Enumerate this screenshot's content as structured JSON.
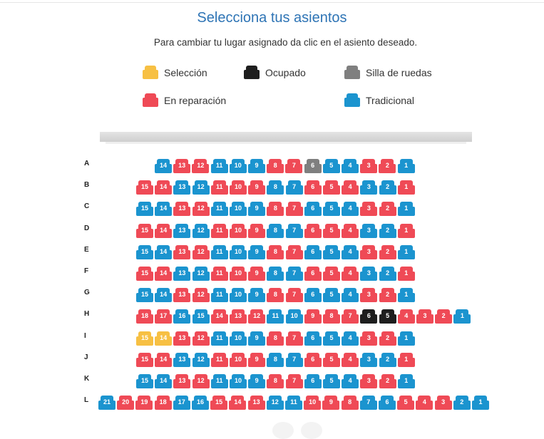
{
  "page": {
    "title": "Selecciona tus asientos",
    "subtitle": "Para cambiar tu lugar asignado da clic en el asiento deseado."
  },
  "colors": {
    "seleccion": "#f7c043",
    "ocupado": "#1e1e1e",
    "silla": "#7f7f7f",
    "reparacion": "#ef4a56",
    "tradicional": "#1b94cf"
  },
  "legend": [
    {
      "key": "seleccion",
      "label": "Selección",
      "icon": "seat-icon"
    },
    {
      "key": "ocupado",
      "label": "Ocupado",
      "icon": "seat-icon"
    },
    {
      "key": "silla",
      "label": "Silla de ruedas",
      "icon": "seat-icon"
    },
    {
      "key": "reparacion",
      "label": "En reparación",
      "icon": "seat-icon"
    },
    {
      "key": "tradicional",
      "label": "Tradicional",
      "icon": "seat-icon"
    }
  ],
  "screen_label": "",
  "rows": [
    {
      "label": "A",
      "seats": [
        [
          "14",
          "t"
        ],
        [
          "13",
          "r"
        ],
        [
          "12",
          "r"
        ],
        [
          "11",
          "t"
        ],
        [
          "10",
          "t"
        ],
        [
          "9",
          "t"
        ],
        [
          "8",
          "r"
        ],
        [
          "7",
          "r"
        ],
        [
          "6",
          "w"
        ],
        [
          "5",
          "t"
        ],
        [
          "4",
          "t"
        ],
        [
          "3",
          "r"
        ],
        [
          "2",
          "r"
        ],
        [
          "1",
          "t"
        ]
      ]
    },
    {
      "label": "B",
      "seats": [
        [
          "15",
          "r"
        ],
        [
          "14",
          "r"
        ],
        [
          "13",
          "t"
        ],
        [
          "12",
          "t"
        ],
        [
          "11",
          "r"
        ],
        [
          "10",
          "r"
        ],
        [
          "9",
          "r"
        ],
        [
          "8",
          "t"
        ],
        [
          "7",
          "t"
        ],
        [
          "6",
          "r"
        ],
        [
          "5",
          "r"
        ],
        [
          "4",
          "r"
        ],
        [
          "3",
          "t"
        ],
        [
          "2",
          "t"
        ],
        [
          "1",
          "r"
        ]
      ]
    },
    {
      "label": "C",
      "seats": [
        [
          "15",
          "t"
        ],
        [
          "14",
          "t"
        ],
        [
          "13",
          "r"
        ],
        [
          "12",
          "r"
        ],
        [
          "11",
          "t"
        ],
        [
          "10",
          "t"
        ],
        [
          "9",
          "t"
        ],
        [
          "8",
          "r"
        ],
        [
          "7",
          "r"
        ],
        [
          "6",
          "t"
        ],
        [
          "5",
          "t"
        ],
        [
          "4",
          "t"
        ],
        [
          "3",
          "r"
        ],
        [
          "2",
          "r"
        ],
        [
          "1",
          "t"
        ]
      ]
    },
    {
      "label": "D",
      "seats": [
        [
          "15",
          "r"
        ],
        [
          "14",
          "r"
        ],
        [
          "13",
          "t"
        ],
        [
          "12",
          "t"
        ],
        [
          "11",
          "r"
        ],
        [
          "10",
          "r"
        ],
        [
          "9",
          "r"
        ],
        [
          "8",
          "t"
        ],
        [
          "7",
          "t"
        ],
        [
          "6",
          "r"
        ],
        [
          "5",
          "r"
        ],
        [
          "4",
          "r"
        ],
        [
          "3",
          "t"
        ],
        [
          "2",
          "t"
        ],
        [
          "1",
          "r"
        ]
      ]
    },
    {
      "label": "E",
      "seats": [
        [
          "15",
          "t"
        ],
        [
          "14",
          "t"
        ],
        [
          "13",
          "r"
        ],
        [
          "12",
          "r"
        ],
        [
          "11",
          "t"
        ],
        [
          "10",
          "t"
        ],
        [
          "9",
          "t"
        ],
        [
          "8",
          "r"
        ],
        [
          "7",
          "r"
        ],
        [
          "6",
          "t"
        ],
        [
          "5",
          "t"
        ],
        [
          "4",
          "t"
        ],
        [
          "3",
          "r"
        ],
        [
          "2",
          "r"
        ],
        [
          "1",
          "t"
        ]
      ]
    },
    {
      "label": "F",
      "seats": [
        [
          "15",
          "r"
        ],
        [
          "14",
          "r"
        ],
        [
          "13",
          "t"
        ],
        [
          "12",
          "t"
        ],
        [
          "11",
          "r"
        ],
        [
          "10",
          "r"
        ],
        [
          "9",
          "r"
        ],
        [
          "8",
          "t"
        ],
        [
          "7",
          "t"
        ],
        [
          "6",
          "r"
        ],
        [
          "5",
          "r"
        ],
        [
          "4",
          "r"
        ],
        [
          "3",
          "t"
        ],
        [
          "2",
          "t"
        ],
        [
          "1",
          "r"
        ]
      ]
    },
    {
      "label": "G",
      "seats": [
        [
          "15",
          "t"
        ],
        [
          "14",
          "t"
        ],
        [
          "13",
          "r"
        ],
        [
          "12",
          "r"
        ],
        [
          "11",
          "t"
        ],
        [
          "10",
          "t"
        ],
        [
          "9",
          "t"
        ],
        [
          "8",
          "r"
        ],
        [
          "7",
          "r"
        ],
        [
          "6",
          "t"
        ],
        [
          "5",
          "t"
        ],
        [
          "4",
          "t"
        ],
        [
          "3",
          "r"
        ],
        [
          "2",
          "r"
        ],
        [
          "1",
          "t"
        ]
      ]
    },
    {
      "label": "H",
      "seats": [
        [
          "18",
          "r"
        ],
        [
          "17",
          "r"
        ],
        [
          "16",
          "t"
        ],
        [
          "15",
          "t"
        ],
        [
          "14",
          "r"
        ],
        [
          "13",
          "r"
        ],
        [
          "12",
          "r"
        ],
        [
          "11",
          "t"
        ],
        [
          "10",
          "t"
        ],
        [
          "9",
          "r"
        ],
        [
          "8",
          "r"
        ],
        [
          "7",
          "r"
        ],
        [
          "6",
          "o"
        ],
        [
          "5",
          "o"
        ],
        [
          "4",
          "r"
        ],
        [
          "3",
          "r"
        ],
        [
          "2",
          "r"
        ],
        [
          "1",
          "t"
        ]
      ]
    },
    {
      "label": "I",
      "seats": [
        [
          "15",
          "s"
        ],
        [
          "14",
          "s"
        ],
        [
          "13",
          "r"
        ],
        [
          "12",
          "r"
        ],
        [
          "11",
          "t"
        ],
        [
          "10",
          "t"
        ],
        [
          "9",
          "t"
        ],
        [
          "8",
          "r"
        ],
        [
          "7",
          "r"
        ],
        [
          "6",
          "t"
        ],
        [
          "5",
          "t"
        ],
        [
          "4",
          "t"
        ],
        [
          "3",
          "r"
        ],
        [
          "2",
          "r"
        ],
        [
          "1",
          "t"
        ]
      ]
    },
    {
      "label": "J",
      "seats": [
        [
          "15",
          "r"
        ],
        [
          "14",
          "r"
        ],
        [
          "13",
          "t"
        ],
        [
          "12",
          "t"
        ],
        [
          "11",
          "r"
        ],
        [
          "10",
          "r"
        ],
        [
          "9",
          "r"
        ],
        [
          "8",
          "t"
        ],
        [
          "7",
          "t"
        ],
        [
          "6",
          "r"
        ],
        [
          "5",
          "r"
        ],
        [
          "4",
          "r"
        ],
        [
          "3",
          "t"
        ],
        [
          "2",
          "t"
        ],
        [
          "1",
          "r"
        ]
      ]
    },
    {
      "label": "K",
      "seats": [
        [
          "15",
          "t"
        ],
        [
          "14",
          "t"
        ],
        [
          "13",
          "r"
        ],
        [
          "12",
          "r"
        ],
        [
          "11",
          "t"
        ],
        [
          "10",
          "t"
        ],
        [
          "9",
          "t"
        ],
        [
          "8",
          "r"
        ],
        [
          "7",
          "r"
        ],
        [
          "6",
          "t"
        ],
        [
          "5",
          "t"
        ],
        [
          "4",
          "t"
        ],
        [
          "3",
          "r"
        ],
        [
          "2",
          "r"
        ],
        [
          "1",
          "t"
        ]
      ]
    },
    {
      "label": "L",
      "seats": [
        [
          "21",
          "t"
        ],
        [
          "20",
          "r"
        ],
        [
          "19",
          "r"
        ],
        [
          "18",
          "r"
        ],
        [
          "17",
          "t"
        ],
        [
          "16",
          "t"
        ],
        [
          "15",
          "r"
        ],
        [
          "14",
          "r"
        ],
        [
          "13",
          "r"
        ],
        [
          "12",
          "t"
        ],
        [
          "11",
          "t"
        ],
        [
          "10",
          "r"
        ],
        [
          "9",
          "r"
        ],
        [
          "8",
          "r"
        ],
        [
          "7",
          "t"
        ],
        [
          "6",
          "t"
        ],
        [
          "5",
          "r"
        ],
        [
          "4",
          "r"
        ],
        [
          "3",
          "r"
        ],
        [
          "2",
          "t"
        ],
        [
          "1",
          "t"
        ]
      ]
    }
  ]
}
